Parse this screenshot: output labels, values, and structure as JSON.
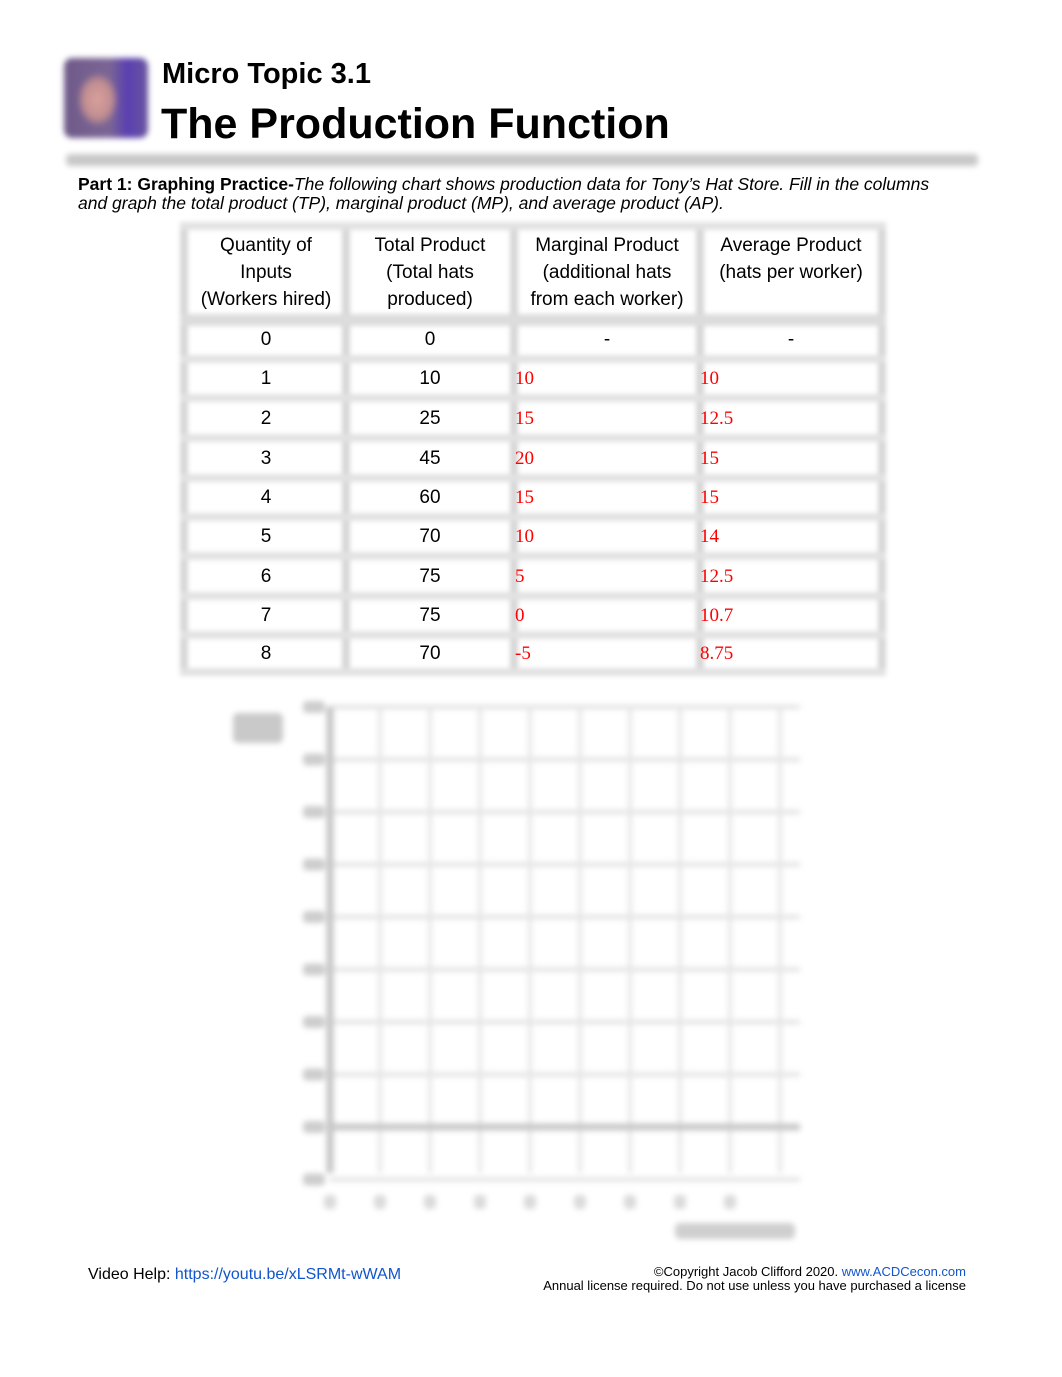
{
  "header": {
    "topic": "Micro Topic 3.1",
    "title": "The Production Function"
  },
  "intro": {
    "bold": "Part 1: Graphing Practice-",
    "italic": "The following chart shows production data for Tony’s Hat Store. Fill in the columns and graph the total product (TP), marginal product (MP), and average product (AP)."
  },
  "table": {
    "headers": [
      [
        "Quantity of",
        "Inputs",
        "(Workers hired)"
      ],
      [
        "Total Product",
        "(Total hats",
        "produced)"
      ],
      [
        "Marginal Product",
        "(additional hats",
        "from each worker)"
      ],
      [
        "Average Product",
        "(hats per worker)",
        ""
      ]
    ],
    "rows": [
      {
        "workers": "0",
        "tp": "0",
        "mp": "-",
        "ap": "-"
      },
      {
        "workers": "1",
        "tp": "10",
        "mp": "10",
        "ap": "10"
      },
      {
        "workers": "2",
        "tp": "25",
        "mp": "15",
        "ap": "12.5"
      },
      {
        "workers": "3",
        "tp": "45",
        "mp": "20",
        "ap": "15"
      },
      {
        "workers": "4",
        "tp": "60",
        "mp": "15",
        "ap": "15"
      },
      {
        "workers": "5",
        "tp": "70",
        "mp": "10",
        "ap": "14"
      },
      {
        "workers": "6",
        "tp": "75",
        "mp": "5",
        "ap": "12.5"
      },
      {
        "workers": "7",
        "tp": "75",
        "mp": "0",
        "ap": "10.7"
      },
      {
        "workers": "8",
        "tp": "70",
        "mp": "-5",
        "ap": "8.75"
      }
    ],
    "answer_color": "#ff0000"
  },
  "graph": {
    "x_gridlines": 10,
    "y_gridlines": 10,
    "x_ticks": 9,
    "y_ticks": 10
  },
  "footer": {
    "video_label": "Video Help: ",
    "video_link": "https://youtu.be/xLSRMt-wWAM",
    "copyright": "©Copyright Jacob Clifford 2020. ",
    "site_link": "www.ACDCecon.com",
    "license": "Annual license required. Do not use unless you have purchased a license"
  }
}
